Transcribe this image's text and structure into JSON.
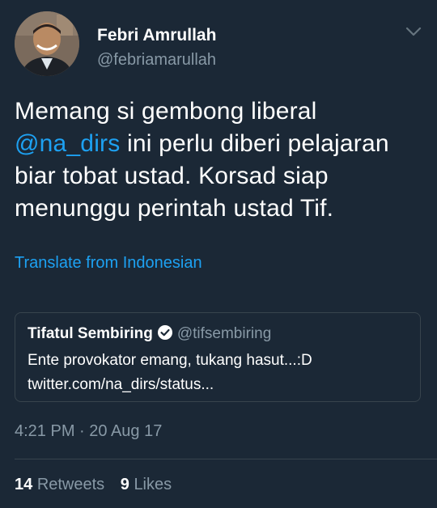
{
  "author": {
    "name": "Febri Amrullah",
    "handle": "@febriamarullah",
    "avatar_icon": "profile-photo"
  },
  "tweet": {
    "text_part1": "Memang si gembong  liberal ",
    "mention": "@na_dirs",
    "text_part2": " ini perlu diberi pelajaran biar tobat ustad.  Korsad siap menunggu perintah ustad Tif.",
    "translate_label": "Translate from Indonesian",
    "timestamp": "4:21 PM · 20 Aug 17"
  },
  "quoted_tweet": {
    "name": "Tifatul Sembiring",
    "verified_icon": "verified-badge-icon",
    "handle": "@tifsembiring",
    "line1": "Ente provokator emang, tukang hasut...:D",
    "line2": "twitter.com/na_dirs/status..."
  },
  "stats": {
    "retweets_count": "14",
    "retweets_label": "Retweets",
    "likes_count": "9",
    "likes_label": "Likes"
  },
  "colors": {
    "background": "#1b2836",
    "link": "#1da1f2",
    "muted": "#8899a6"
  }
}
